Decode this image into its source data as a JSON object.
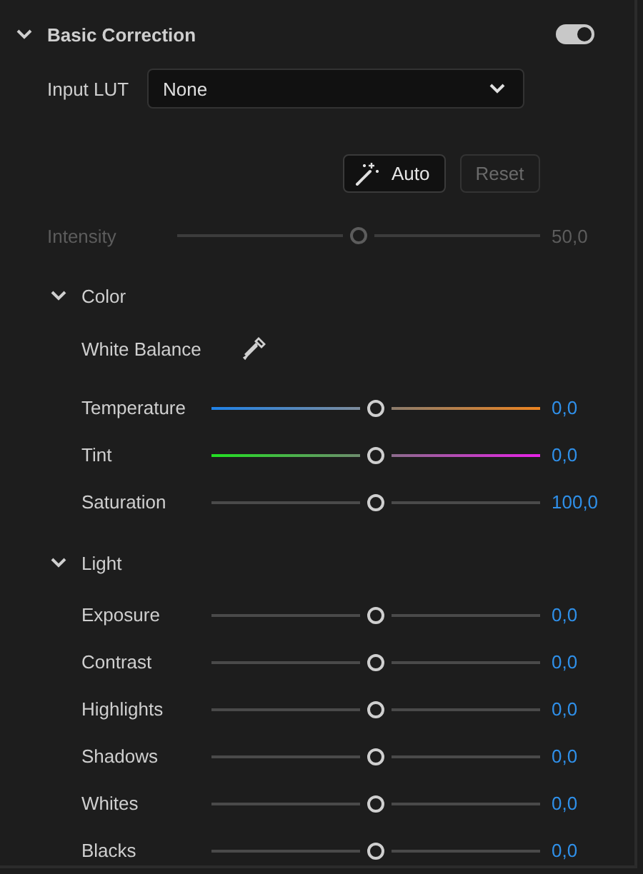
{
  "section": {
    "title": "Basic Correction",
    "expanded": true,
    "toggle": {
      "on": true
    }
  },
  "input_lut": {
    "label": "Input LUT",
    "value": "None"
  },
  "buttons": [
    {
      "label": "Auto",
      "disabled": false,
      "icon": true
    },
    {
      "label": "Reset",
      "disabled": true,
      "icon": false
    }
  ],
  "intensity": {
    "label": "Intensity",
    "level": 0.5,
    "reading": "50,0",
    "disabled": true
  },
  "groups": [
    {
      "title": "Color",
      "expanded": true,
      "white_balance": {
        "label": "White Balance"
      },
      "sliders": [
        {
          "name": "Temperature",
          "kind": "temperature",
          "level": 0.5,
          "reading": "0,0"
        },
        {
          "name": "Tint",
          "kind": "tint",
          "level": 0.5,
          "reading": "0,0"
        },
        {
          "name": "Saturation",
          "kind": "plain",
          "level": 0.5,
          "reading": "100,0"
        }
      ]
    },
    {
      "title": "Light",
      "expanded": true,
      "sliders": [
        {
          "name": "Exposure",
          "kind": "plain",
          "level": 0.5,
          "reading": "0,0"
        },
        {
          "name": "Contrast",
          "kind": "plain",
          "level": 0.5,
          "reading": "0,0"
        },
        {
          "name": "Highlights",
          "kind": "plain",
          "level": 0.5,
          "reading": "0,0"
        },
        {
          "name": "Shadows",
          "kind": "plain",
          "level": 0.5,
          "reading": "0,0"
        },
        {
          "name": "Whites",
          "kind": "plain",
          "level": 0.5,
          "reading": "0,0"
        },
        {
          "name": "Blacks",
          "kind": "plain",
          "level": 0.5,
          "reading": "0,0"
        }
      ]
    }
  ]
}
